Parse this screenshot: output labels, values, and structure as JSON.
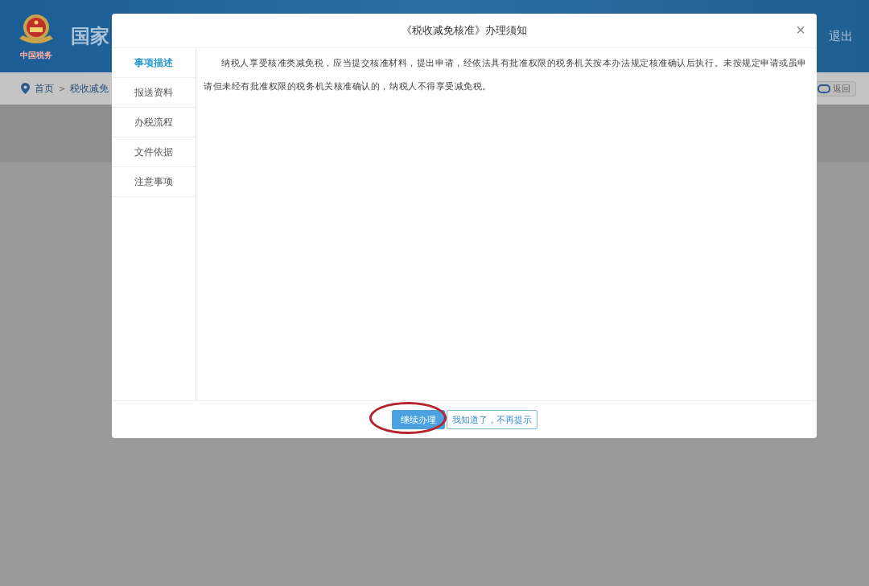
{
  "header": {
    "site_title": "国家",
    "logo_caption": "中国税务",
    "logout": "退出"
  },
  "breadcrumb": {
    "items": [
      "首页",
      "税收减免"
    ],
    "separator": ">",
    "back": "返回"
  },
  "dialog": {
    "title": "《税收减免核准》办理须知",
    "close": "×",
    "tabs": [
      {
        "label": "事项描述",
        "selected": true
      },
      {
        "label": "报送资料",
        "selected": false
      },
      {
        "label": "办税流程",
        "selected": false
      },
      {
        "label": "文件依据",
        "selected": false
      },
      {
        "label": "注意事项",
        "selected": false
      }
    ],
    "paragraph": "纳税人享受核准类减免税，应当提交核准材料，提出申请，经依法具有批准权限的税务机关按本办法规定核准确认后执行。未按规定申请或虽申请但未经有批准权限的税务机关核准确认的，纳税人不得享受减免税。",
    "buttons": [
      {
        "label": "继续办理",
        "kind": "primary",
        "highlighted": true
      },
      {
        "label": "我知道了，不再提示",
        "kind": "outline",
        "highlighted": false
      }
    ]
  }
}
